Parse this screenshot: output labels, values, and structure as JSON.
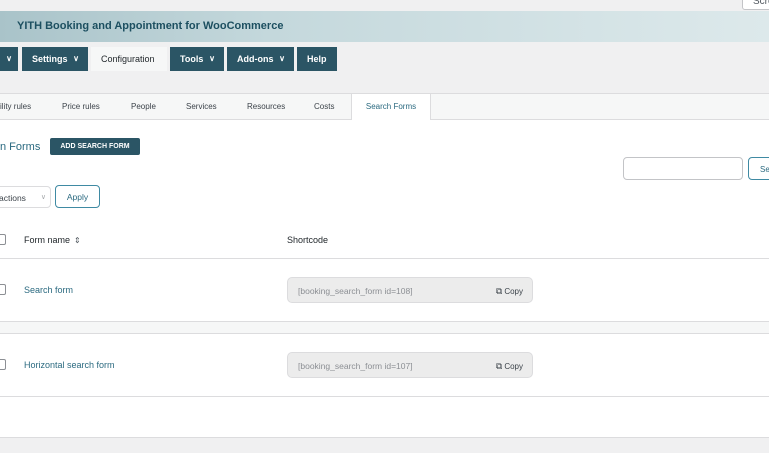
{
  "screen_options": {
    "label": "Scre"
  },
  "banner": {
    "title": "YITH Booking and Appointment for WooCommerce"
  },
  "topnav": {
    "items": [
      {
        "label": "",
        "chevron": "▾"
      },
      {
        "label": "Settings",
        "chevron": "▾"
      },
      {
        "label": "Configuration",
        "chevron": ""
      },
      {
        "label": "Tools",
        "chevron": "▾"
      },
      {
        "label": "Add-ons",
        "chevron": "▾"
      },
      {
        "label": "Help",
        "chevron": ""
      }
    ],
    "active": "Configuration"
  },
  "tabs": {
    "items": [
      "ility rules",
      "Price rules",
      "People",
      "Services",
      "Resources",
      "Costs",
      "Search Forms"
    ],
    "active": "Search Forms"
  },
  "page": {
    "heading": "n Forms",
    "add_button": "ADD SEARCH FORM",
    "search_button": "Se",
    "bulk_actions": "actions",
    "apply_button": "Apply"
  },
  "table": {
    "columns": {
      "name": "Form name",
      "shortcode": "Shortcode"
    },
    "sort_icon": "⇕",
    "copy_label": "Copy",
    "rows": [
      {
        "name": "Search form",
        "shortcode": "[booking_search_form id=108]"
      },
      {
        "name": "Horizontal search form",
        "shortcode": "[booking_search_form id=107]"
      }
    ]
  },
  "colors": {
    "accent": "#2b5565",
    "link": "#2b6a80"
  }
}
